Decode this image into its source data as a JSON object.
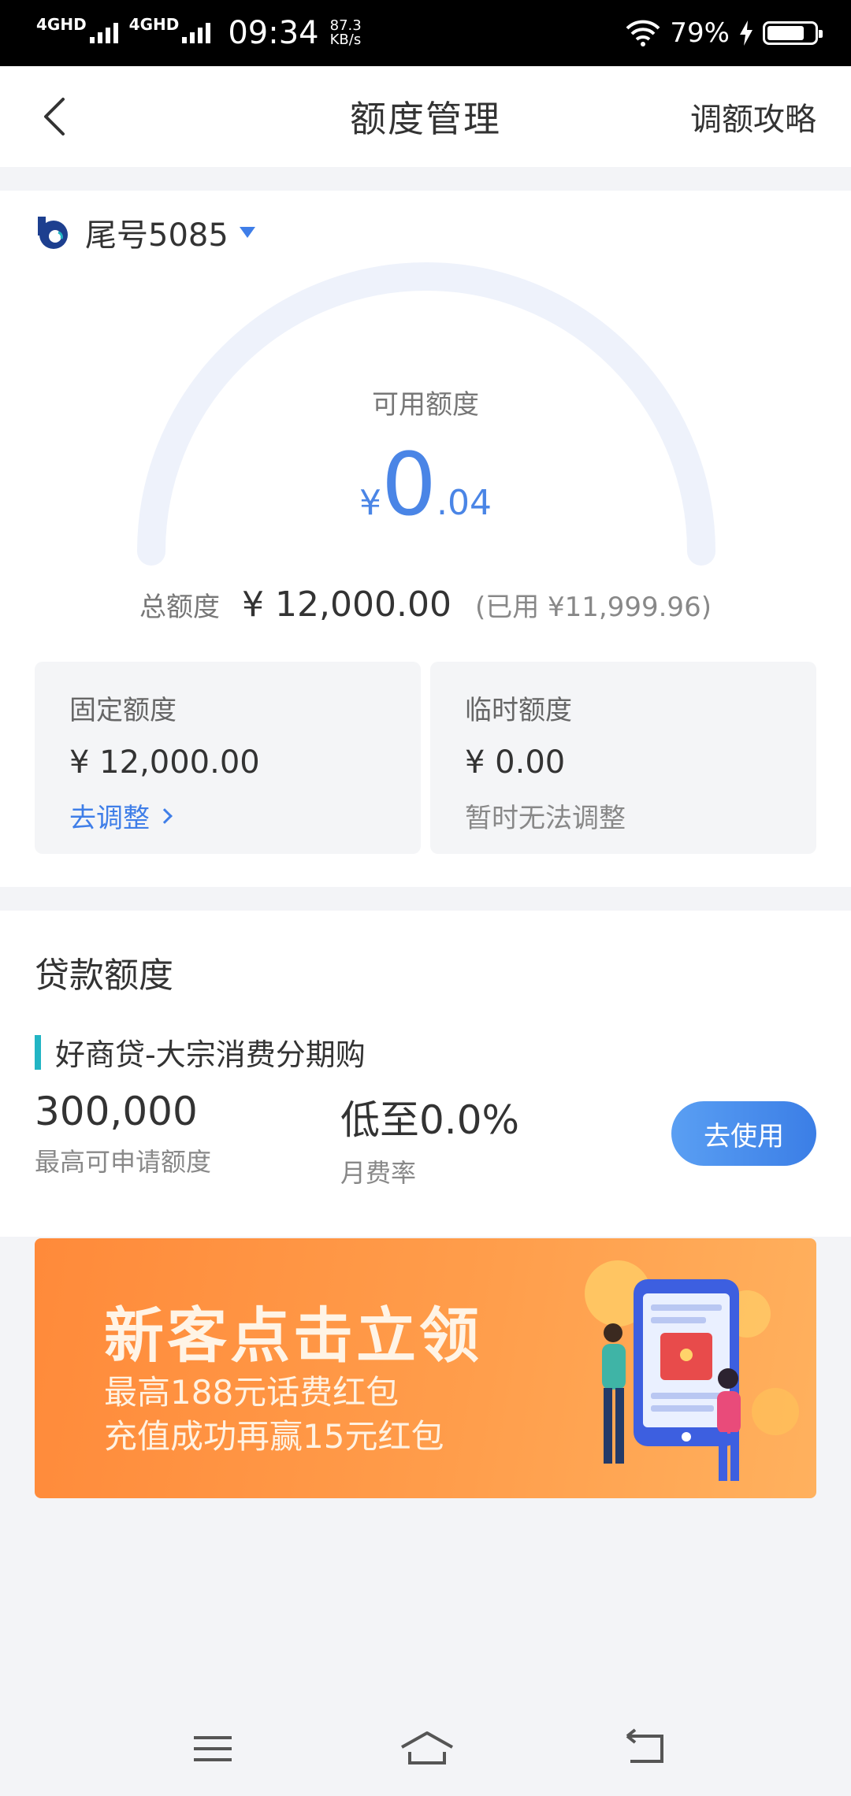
{
  "status": {
    "signal1": "4GHD",
    "signal2": "4GHD",
    "time": "09:34",
    "speed_value": "87.3",
    "speed_unit": "KB/s",
    "battery": "79%",
    "battery_level": 0.79
  },
  "nav": {
    "title": "额度管理",
    "right_link": "调额攻略"
  },
  "account": {
    "label": "尾号5085"
  },
  "gauge": {
    "label": "可用额度",
    "currency": "¥",
    "integer": "0",
    "decimal": ".04"
  },
  "total": {
    "label": "总额度",
    "amount": "¥ 12,000.00",
    "used": "(已用 ¥11,999.96)"
  },
  "fixed": {
    "title": "固定额度",
    "amount": "¥ 12,000.00",
    "action": "去调整"
  },
  "temp": {
    "title": "临时额度",
    "amount": "¥ 0.00",
    "note": "暂时无法调整"
  },
  "loan": {
    "section_title": "贷款额度",
    "product": "好商贷-大宗消费分期购",
    "max_amount": "300,000",
    "max_label": "最高可申请额度",
    "rate": "低至0.0%",
    "rate_label": "月费率",
    "button": "去使用"
  },
  "banner": {
    "headline": "新客点击立领",
    "line1": "最高188元话费红包",
    "line2": "充值成功再赢15元红包"
  },
  "colors": {
    "accent": "#3f7ee8",
    "gauge_track": "#eef2fb",
    "banner": "#ff9240",
    "product_mark": "#22b5c4"
  }
}
